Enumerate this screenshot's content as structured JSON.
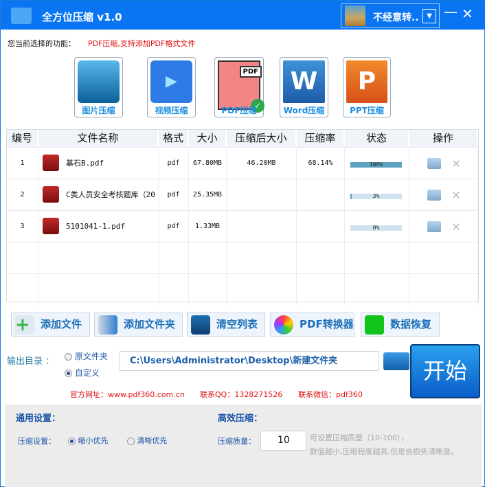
{
  "app": {
    "title": "全方位压缩 v1.0",
    "user_name": "不经意转..",
    "accent": "#0a75f2"
  },
  "function_bar": {
    "label": "您当前选择的功能：",
    "value": "PDF压缩,支持添加PDF格式文件"
  },
  "modes": [
    {
      "label": "图片压缩",
      "icon": "image-icon"
    },
    {
      "label": "视频压缩",
      "icon": "video-icon"
    },
    {
      "label": "PDF压缩",
      "icon": "pdf-icon",
      "selected": true
    },
    {
      "label": "Word压缩",
      "icon": "word-icon"
    },
    {
      "label": "PPT压缩",
      "icon": "ppt-icon"
    }
  ],
  "table": {
    "headers": [
      "编号",
      "文件名称",
      "格式",
      "大小",
      "压缩后大小",
      "压缩率",
      "状态",
      "操作"
    ],
    "rows": [
      {
        "no": "1",
        "name": "基石B.pdf",
        "format": "pdf",
        "size": "67.80MB",
        "compressed": "46.20MB",
        "ratio": "68.14%",
        "progress": 100,
        "progress_label": "100%"
      },
      {
        "no": "2",
        "name": "C类人员安全考核题库（20",
        "format": "pdf",
        "size": "25.35MB",
        "compressed": "",
        "ratio": "",
        "progress": 3,
        "progress_label": "3%"
      },
      {
        "no": "3",
        "name": "5101041-1.pdf",
        "format": "pdf",
        "size": "1.33MB",
        "compressed": "",
        "ratio": "",
        "progress": 0,
        "progress_label": "0%"
      }
    ]
  },
  "toolbar": {
    "add_file": "添加文件",
    "add_folder": "添加文件夹",
    "clear_list": "清空列表",
    "pdf_converter": "PDF转换器",
    "data_recovery": "数据恢复"
  },
  "output": {
    "label": "输出目录 ：",
    "option_original": "原文件夹",
    "option_custom": "自定义",
    "selected": "自定义",
    "path": "C:\\Users\\Administrator\\Desktop\\新建文件夹",
    "start": "开始"
  },
  "contacts": {
    "website": "官方网址：www.pdf360.com.cn",
    "qq": "联系QQ：1328271526",
    "wechat": "联系微信：pdf360"
  },
  "settings": {
    "general_title": "通用设置：",
    "compress_label": "压缩设置：",
    "opt_small": "缩小优先",
    "opt_clear": "清晰优先",
    "selected": "缩小优先",
    "efficient_title": "高效压缩：",
    "quality_label": "压缩质量：",
    "quality_value": "10",
    "hint1": "可设置压缩质量（10-100），",
    "hint2": "数值越小,压缩程度越高,但是会损失清晰度。"
  }
}
